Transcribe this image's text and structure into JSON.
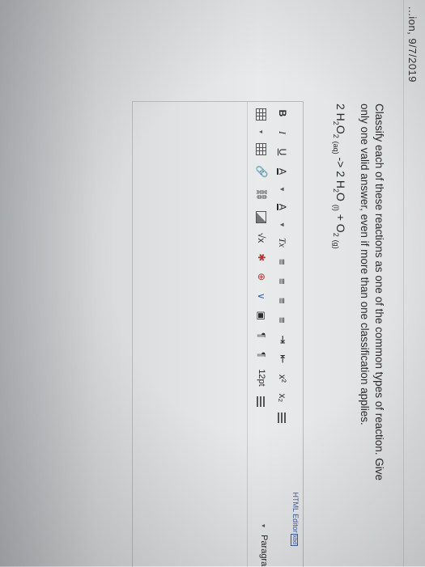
{
  "header": {
    "fragment": "...ion, 9/7/2019"
  },
  "question": {
    "text": "Classify each of these reactions as one of the common types of reaction. Give only one valid answer, even if more than one classification applies.",
    "equation": {
      "c1": "2 H",
      "s1": "2",
      "c2": "O",
      "s2": "2",
      "st1": "(aq)",
      "arrow": " -> 2 H",
      "s3": "2",
      "c3": "O",
      "st2": "(l)",
      "plus": " + O",
      "s4": "2",
      "st3": "(g)"
    }
  },
  "editor": {
    "label": "HTML Editor",
    "label_kb": "kbd",
    "toolbar_row1": {
      "bold": "B",
      "italic": "I",
      "underline": "U",
      "font_color": "A",
      "highlight": "A",
      "clear_format": "Tx",
      "align_left": "≡",
      "align_center": "≡",
      "align_right": "≡",
      "justify": "≡",
      "indent": "⇥",
      "outdent": "⇤",
      "superscript": "x²",
      "subscript": "x₂",
      "bullet_list_icon": "bullet-list-icon"
    },
    "toolbar_row2": {
      "table_icon": "table-icon",
      "table_caret": "▾",
      "media_icon": "media-icon",
      "link": "🔗",
      "unlink": "⛓",
      "image_icon": "image-icon",
      "math": "√x",
      "special1": "✱",
      "special2": "⊕",
      "special3": "∨",
      "embed": "▣",
      "ltr": "¶",
      "rtl": "¶",
      "font_size": "12pt",
      "numbered_list_icon": "numbered-list-icon",
      "paragraph_caret": "▾",
      "paragraph_value": "Paragra"
    }
  },
  "colors": {
    "text": "#2a2a2a",
    "accent": "#3a5f9e",
    "red_icon": "#b83232",
    "blue_icon": "#2d6fb0"
  }
}
